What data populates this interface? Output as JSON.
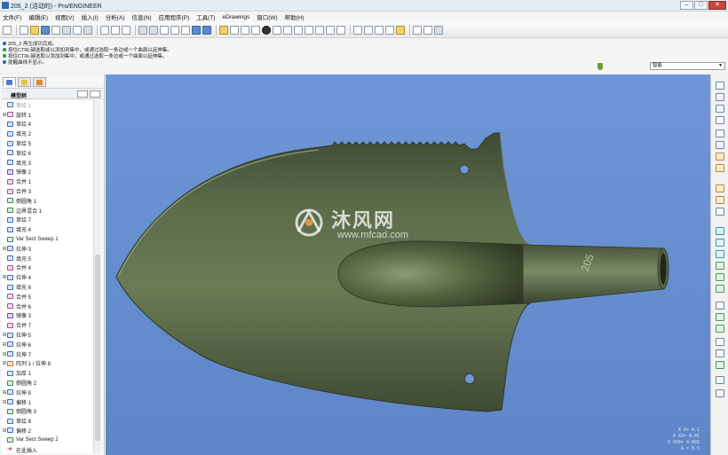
{
  "window": {
    "title": "205_2 (活动的) - Pro/ENGINEER",
    "buttons": [
      "–",
      "□",
      "✕"
    ]
  },
  "menubar": [
    "文件(F)",
    "编辑(E)",
    "视图(V)",
    "插入(I)",
    "分析(A)",
    "信息(N)",
    "应用程序(P)",
    "工具(T)",
    "eDrawings",
    "窗口(W)",
    "帮助(H)"
  ],
  "messages": [
    {
      "text": "205_2 再生成功完成。",
      "type": "info"
    },
    {
      "text": "按住CTRL键选取或以添加到集中，或通过选取一条边或一个曲面以延伸集。",
      "type": "prompt"
    },
    {
      "text": "按住CTRL键选取以添加到集中，或通过选取一条边或一个曲面以延伸集。",
      "type": "prompt"
    },
    {
      "text": "提醒曲线不显示。",
      "type": "info"
    }
  ],
  "filter": {
    "value": "智能"
  },
  "model_tree": {
    "header": "模型树",
    "items": [
      {
        "label": "草绘 1",
        "expandable": false,
        "icon": "sketch-icon",
        "faded": true
      },
      {
        "label": "旋转 1",
        "expandable": true,
        "icon": "revolve-icon"
      },
      {
        "label": "草绘 4",
        "expandable": false,
        "icon": "sketch-icon"
      },
      {
        "label": "填充 2",
        "expandable": false,
        "icon": "fill-icon"
      },
      {
        "label": "草绘 5",
        "expandable": false,
        "icon": "sketch-icon"
      },
      {
        "label": "草绘 6",
        "expandable": false,
        "icon": "sketch-icon"
      },
      {
        "label": "填充 3",
        "expandable": false,
        "icon": "fill-icon"
      },
      {
        "label": "镜像 2",
        "expandable": false,
        "icon": "mirror-icon"
      },
      {
        "label": "合并 1",
        "expandable": false,
        "icon": "merge-icon"
      },
      {
        "label": "合并 3",
        "expandable": false,
        "icon": "merge-icon"
      },
      {
        "label": "倒圆角 1",
        "expandable": false,
        "icon": "round-icon"
      },
      {
        "label": "边界混合 1",
        "expandable": false,
        "icon": "boundary-blend-icon"
      },
      {
        "label": "草绘 7",
        "expandable": false,
        "icon": "sketch-icon"
      },
      {
        "label": "填充 4",
        "expandable": false,
        "icon": "fill-icon"
      },
      {
        "label": "Var Sect Sweep 1",
        "expandable": false,
        "icon": "sweep-icon"
      },
      {
        "label": "拉伸 3",
        "expandable": true,
        "icon": "extrude-icon"
      },
      {
        "label": "填充 5",
        "expandable": false,
        "icon": "fill-icon"
      },
      {
        "label": "合并 4",
        "expandable": false,
        "icon": "merge-icon"
      },
      {
        "label": "拉伸 4",
        "expandable": true,
        "icon": "extrude-icon"
      },
      {
        "label": "填充 6",
        "expandable": false,
        "icon": "fill-icon"
      },
      {
        "label": "合并 5",
        "expandable": false,
        "icon": "merge-icon"
      },
      {
        "label": "合并 6",
        "expandable": false,
        "icon": "merge-icon"
      },
      {
        "label": "镜像 3",
        "expandable": false,
        "icon": "mirror-icon"
      },
      {
        "label": "合并 7",
        "expandable": false,
        "icon": "merge-icon"
      },
      {
        "label": "拉伸 5",
        "expandable": true,
        "icon": "extrude-icon"
      },
      {
        "label": "拉伸 6",
        "expandable": true,
        "icon": "extrude-icon"
      },
      {
        "label": "拉伸 7",
        "expandable": true,
        "icon": "extrude-icon"
      },
      {
        "label": "阵列 1 / 拉伸 8",
        "expandable": true,
        "icon": "pattern-icon"
      },
      {
        "label": "加厚 1",
        "expandable": false,
        "icon": "thicken-icon"
      },
      {
        "label": "倒圆角 2",
        "expandable": false,
        "icon": "round-icon"
      },
      {
        "label": "拉伸 8",
        "expandable": true,
        "icon": "extrude-icon"
      },
      {
        "label": "偏移 1",
        "expandable": true,
        "icon": "offset-icon"
      },
      {
        "label": "倒圆角 3",
        "expandable": false,
        "icon": "round-icon"
      },
      {
        "label": "草绘 8",
        "expandable": false,
        "icon": "sketch-icon"
      },
      {
        "label": "偏移 2",
        "expandable": true,
        "icon": "offset-icon"
      },
      {
        "label": "Var Sect Sweep 2",
        "expandable": false,
        "icon": "sweep-icon"
      },
      {
        "label": "在此插入",
        "expandable": false,
        "icon": "insert-here-icon"
      }
    ]
  },
  "viewport": {
    "model_label": "205",
    "watermark": {
      "name": "沐风网",
      "url": "www.mfcad.com"
    },
    "coords": [
      "X X= 0.1",
      "X XX= 0.01",
      "X XXX= 0.001",
      "A = 0.5"
    ]
  }
}
